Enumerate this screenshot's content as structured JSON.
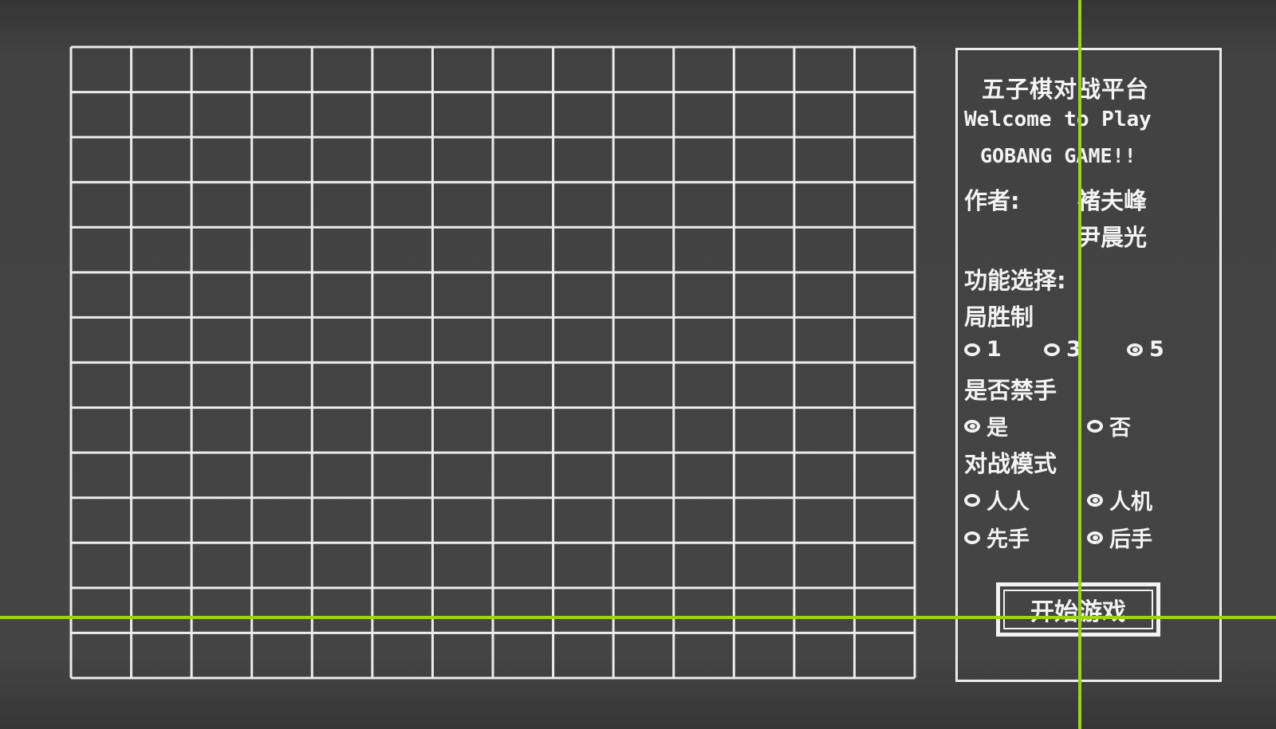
{
  "panel": {
    "title": "五子棋对战平台",
    "welcome_line": "Welcome to Play",
    "game_line": "GOBANG GAME!!",
    "author_label": "作者:",
    "authors": [
      "褚夫峰",
      "尹晨光"
    ],
    "function_label": "功能选择:",
    "rounds": {
      "label": "局胜制",
      "options": [
        {
          "label": "1",
          "selected": false
        },
        {
          "label": "3",
          "selected": false
        },
        {
          "label": "5",
          "selected": true
        }
      ]
    },
    "forbidden": {
      "label": "是否禁手",
      "options": [
        {
          "label": "是",
          "selected": true
        },
        {
          "label": "否",
          "selected": false
        }
      ]
    },
    "mode": {
      "label": "对战模式",
      "options": [
        {
          "label": "人人",
          "selected": false
        },
        {
          "label": "人机",
          "selected": true
        }
      ]
    },
    "order": {
      "options": [
        {
          "label": "先手",
          "selected": false
        },
        {
          "label": "后手",
          "selected": true
        }
      ]
    },
    "start_button": "开始游戏"
  },
  "board": {
    "columns": 14,
    "rows": 14
  },
  "colors": {
    "background": "#3f3f3f",
    "lines": "#ececec",
    "crosshair": "#9bd21e"
  }
}
